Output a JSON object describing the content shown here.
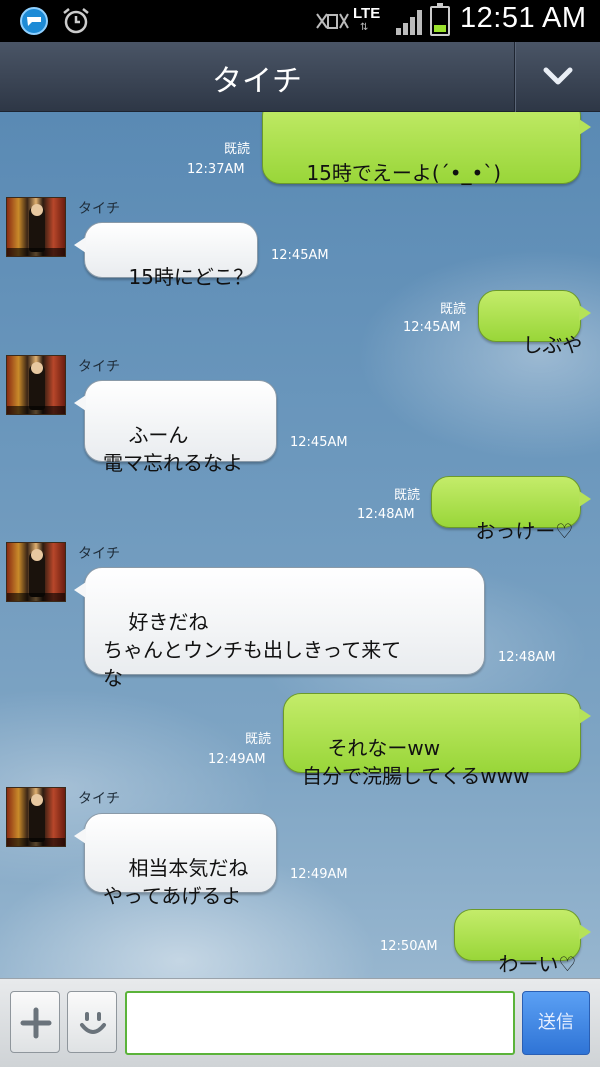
{
  "status_bar": {
    "network": "LTE",
    "network_arrows": "⇅",
    "time": "12:51 AM"
  },
  "header": {
    "title": "タイチ"
  },
  "messages": [
    {
      "side": "out",
      "text": "15時でえーよ(´•_•`)",
      "read": "既読",
      "time": "12:37AM"
    },
    {
      "side": "in",
      "sender": "タイチ",
      "text": "15時にどこ？",
      "time": "12:45AM"
    },
    {
      "side": "out",
      "text": "しぶや",
      "read": "既読",
      "time": "12:45AM"
    },
    {
      "side": "in",
      "sender": "タイチ",
      "text": "ふーん\n電マ忘れるなよ",
      "time": "12:45AM"
    },
    {
      "side": "out",
      "text": "おっけー♡",
      "read": "既読",
      "time": "12:48AM"
    },
    {
      "side": "in",
      "sender": "タイチ",
      "text": "好きだね\nちゃんとウンチも出しきって来て\nな",
      "time": "12:48AM"
    },
    {
      "side": "out",
      "text": "それなーww\n自分で浣腸してくるwww",
      "read": "既読",
      "time": "12:49AM"
    },
    {
      "side": "in",
      "sender": "タイチ",
      "text": "相当本気だね\nやってあげるよ",
      "time": "12:49AM"
    },
    {
      "side": "out",
      "text": "わーい♡",
      "time": "12:50AM"
    }
  ],
  "input_bar": {
    "placeholder": "",
    "send_label": "送信"
  },
  "colors": {
    "outgoing_bubble": "#a8dd45",
    "incoming_bubble": "#ffffff",
    "header": "#3a4454",
    "send_button": "#3c82e0"
  }
}
